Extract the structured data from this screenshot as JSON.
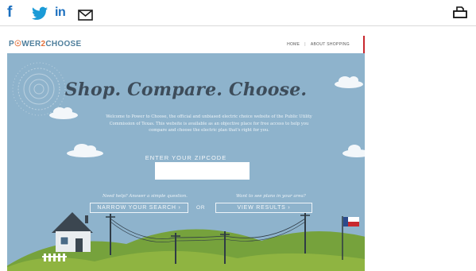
{
  "share_bar": {
    "facebook_glyph": "f",
    "linkedin_glyph": "in",
    "icons": [
      "facebook-icon",
      "twitter-icon",
      "linkedin-icon",
      "mail-icon",
      "print-icon"
    ],
    "accent": "#1b6fbf"
  },
  "site": {
    "logo_part1": "P",
    "logo_part2": "WER",
    "logo_part3": "2",
    "logo_part4": "CHOOSE",
    "nav_home": "HOME",
    "nav_separator": "|",
    "nav_about": "ABOUT SHOPPING",
    "brand_blue": "#4f7f9c",
    "brand_orange": "#e2703b"
  },
  "hero": {
    "headline": "Shop. Compare. Choose.",
    "intro": "Welcome to Power to Choose, the official and unbiased electric choice website of the Public Utility Commission of Texas. This website is available as an objective place for free access to help you compare and choose the electric plan that's right for you.",
    "zip_label": "ENTER YOUR ZIPCODE",
    "zip_value": "",
    "help_left": "Need help? Answer a simple question.",
    "narrow_button": "NARROW YOUR SEARCH  ›",
    "or_label": "OR",
    "help_right": "Want to see plans in your area?",
    "view_button": "VIEW RESULTS  ›",
    "sky_color": "#8eb3cc",
    "hill_color": "#8fb441"
  }
}
